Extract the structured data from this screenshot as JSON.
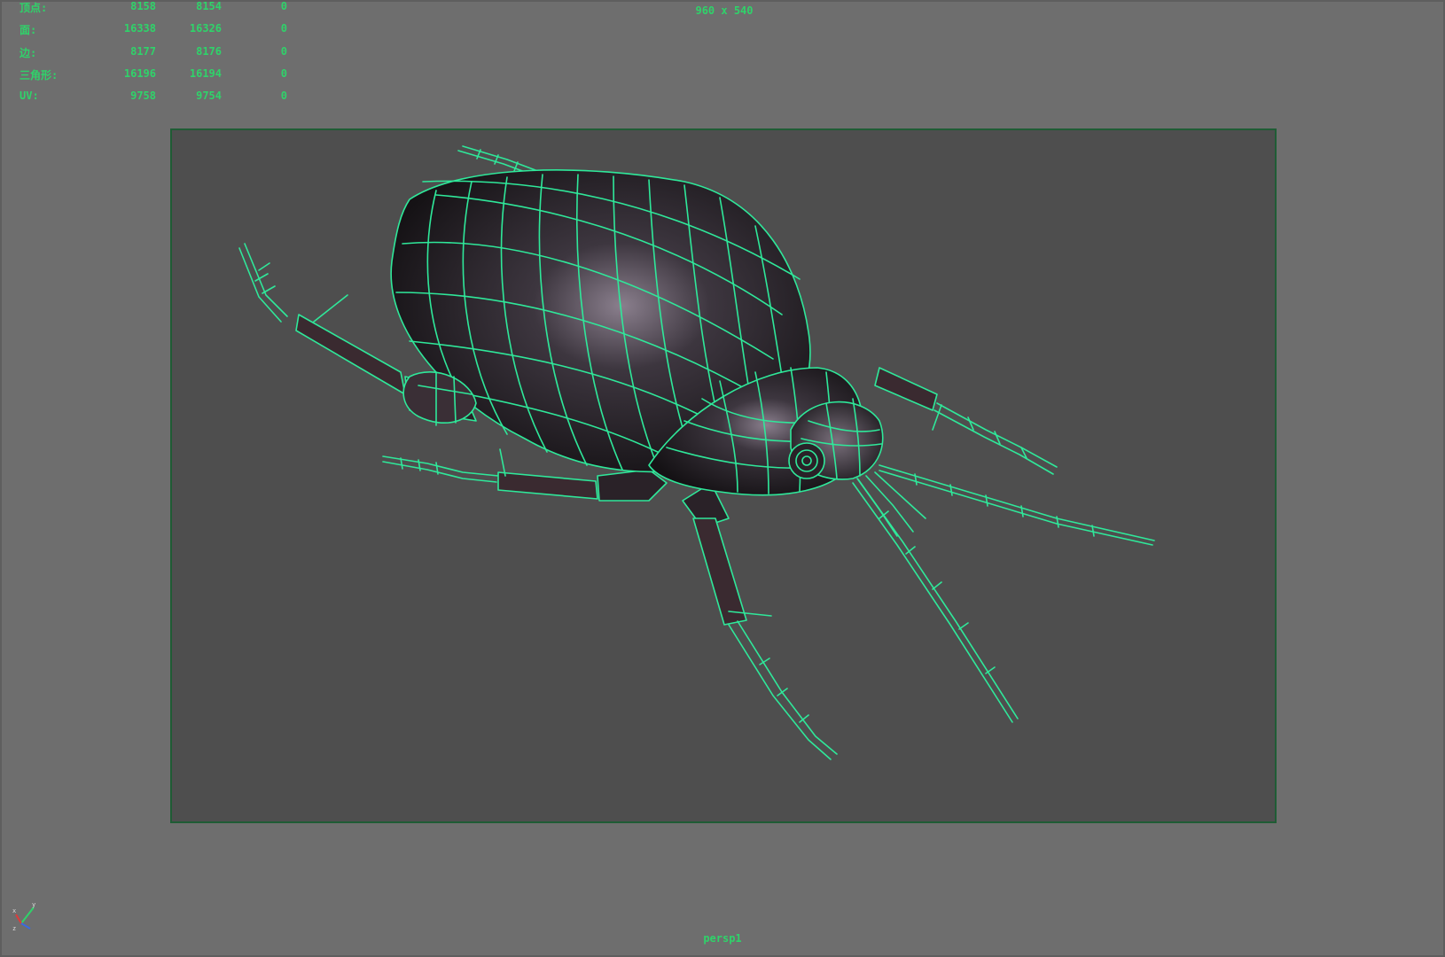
{
  "hud": {
    "rows": [
      {
        "label": "顶点:",
        "v1": "8158",
        "v2": "8154",
        "v3": "0"
      },
      {
        "label": "面:",
        "v1": "16338",
        "v2": "16326",
        "v3": "0"
      },
      {
        "label": "边:",
        "v1": "8177",
        "v2": "8176",
        "v3": "0"
      },
      {
        "label": "三角形:",
        "v1": "16196",
        "v2": "16194",
        "v3": "0"
      },
      {
        "label": "UV:",
        "v1": "9758",
        "v2": "9754",
        "v3": "0"
      }
    ]
  },
  "resolution_gate": {
    "label": "960 x 540"
  },
  "camera": {
    "name": "persp1"
  },
  "colors": {
    "hud_text": "#2fd36a",
    "wireframe": "#2fe89a",
    "background": "#6e6e6e",
    "gate_fill": "#4e4e4e"
  },
  "icons": {
    "axis": "axis-gizmo-icon"
  }
}
